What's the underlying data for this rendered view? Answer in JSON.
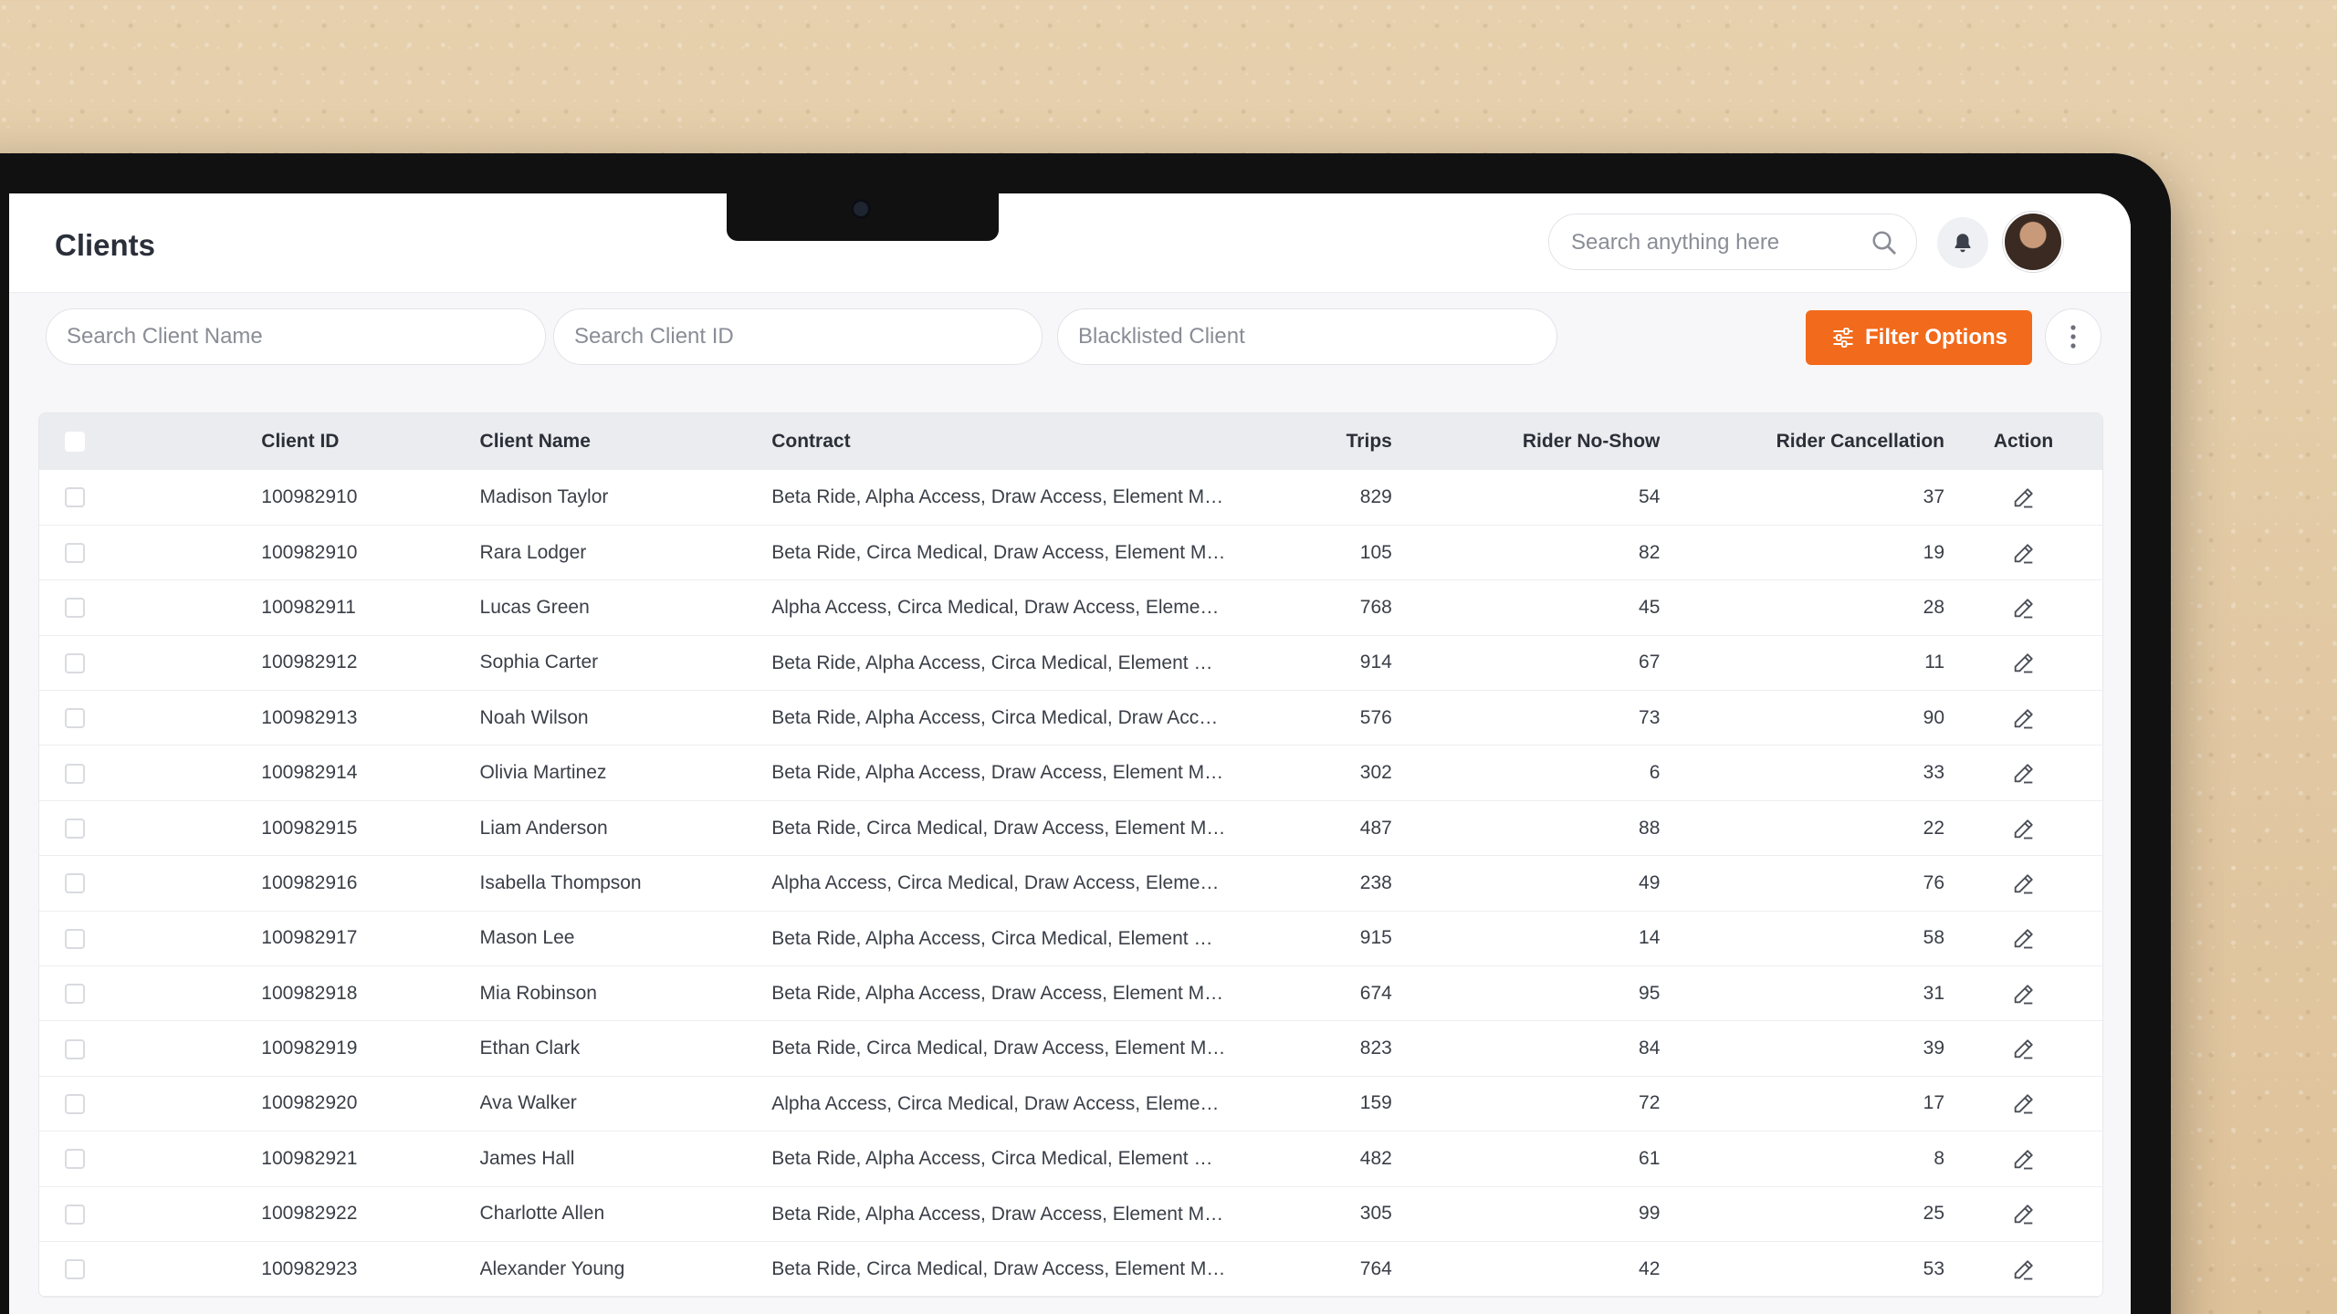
{
  "header": {
    "title": "Clients",
    "search_placeholder": "Search anything here",
    "icons": [
      "search-icon",
      "bell-icon",
      "avatar"
    ]
  },
  "filters": {
    "client_name_placeholder": "Search Client Name",
    "client_id_placeholder": "Search Client ID",
    "blacklisted_placeholder": "Blacklisted Client",
    "filter_button_label": "Filter Options",
    "icons": [
      "sliders-icon",
      "more-vertical-icon"
    ]
  },
  "colors": {
    "accent": "#f26a1b",
    "header_row": "#ebecef",
    "background": "#f7f7f9"
  },
  "table": {
    "columns": {
      "client_id": "Client ID",
      "client_name": "Client Name",
      "contract": "Contract",
      "trips": "Trips",
      "rider_no_show": "Rider No-Show",
      "rider_cancellation": "Rider Cancellation",
      "action": "Action"
    },
    "rows": [
      {
        "id": "100982910",
        "name": "Madison Taylor",
        "contract": "Beta Ride, Alpha Access, Draw Access, Element Medic...",
        "trips": "829",
        "no_show": "54",
        "cancellation": "37"
      },
      {
        "id": "100982910",
        "name": "Rara Lodger",
        "contract": "Beta Ride, Circa Medical, Draw Access, Element Medi...",
        "trips": "105",
        "no_show": "82",
        "cancellation": "19"
      },
      {
        "id": "100982911",
        "name": "Lucas Green",
        "contract": "Alpha Access, Circa Medical, Draw Access, Element M...",
        "trips": "768",
        "no_show": "45",
        "cancellation": "28"
      },
      {
        "id": "100982912",
        "name": "Sophia Carter",
        "contract": "Beta Ride, Alpha Access, Circa Medical, Element Medi...",
        "trips": "914",
        "no_show": "67",
        "cancellation": "11"
      },
      {
        "id": "100982913",
        "name": "Noah Wilson",
        "contract": "Beta Ride, Alpha Access, Circa Medical, Draw Access",
        "trips": "576",
        "no_show": "73",
        "cancellation": "90"
      },
      {
        "id": "100982914",
        "name": "Olivia Martinez",
        "contract": "Beta Ride, Alpha Access, Draw Access, Element Medic...",
        "trips": "302",
        "no_show": "6",
        "cancellation": "33"
      },
      {
        "id": "100982915",
        "name": "Liam Anderson",
        "contract": "Beta Ride, Circa Medical, Draw Access, Element Medi...",
        "trips": "487",
        "no_show": "88",
        "cancellation": "22"
      },
      {
        "id": "100982916",
        "name": "Isabella Thompson",
        "contract": "Alpha Access, Circa Medical, Draw Access, Element M...",
        "trips": "238",
        "no_show": "49",
        "cancellation": "76"
      },
      {
        "id": "100982917",
        "name": "Mason Lee",
        "contract": "Beta Ride, Alpha Access, Circa Medical, Element Medi...",
        "trips": "915",
        "no_show": "14",
        "cancellation": "58"
      },
      {
        "id": "100982918",
        "name": "Mia Robinson",
        "contract": "Beta Ride, Alpha Access, Draw Access, Element Medic...",
        "trips": "674",
        "no_show": "95",
        "cancellation": "31"
      },
      {
        "id": "100982919",
        "name": "Ethan Clark",
        "contract": "Beta Ride, Circa Medical, Draw Access, Element Medi...",
        "trips": "823",
        "no_show": "84",
        "cancellation": "39"
      },
      {
        "id": "100982920",
        "name": "Ava Walker",
        "contract": "Alpha Access, Circa Medical, Draw Access, Element M...",
        "trips": "159",
        "no_show": "72",
        "cancellation": "17"
      },
      {
        "id": "100982921",
        "name": "James Hall",
        "contract": "Beta Ride, Alpha Access, Circa Medical, Element Medi...",
        "trips": "482",
        "no_show": "61",
        "cancellation": "8"
      },
      {
        "id": "100982922",
        "name": "Charlotte Allen",
        "contract": "Beta Ride, Alpha Access, Draw Access, Element Medic...",
        "trips": "305",
        "no_show": "99",
        "cancellation": "25"
      },
      {
        "id": "100982923",
        "name": "Alexander Young",
        "contract": "Beta Ride, Circa Medical, Draw Access, Element Medi...",
        "trips": "764",
        "no_show": "42",
        "cancellation": "53"
      }
    ]
  }
}
